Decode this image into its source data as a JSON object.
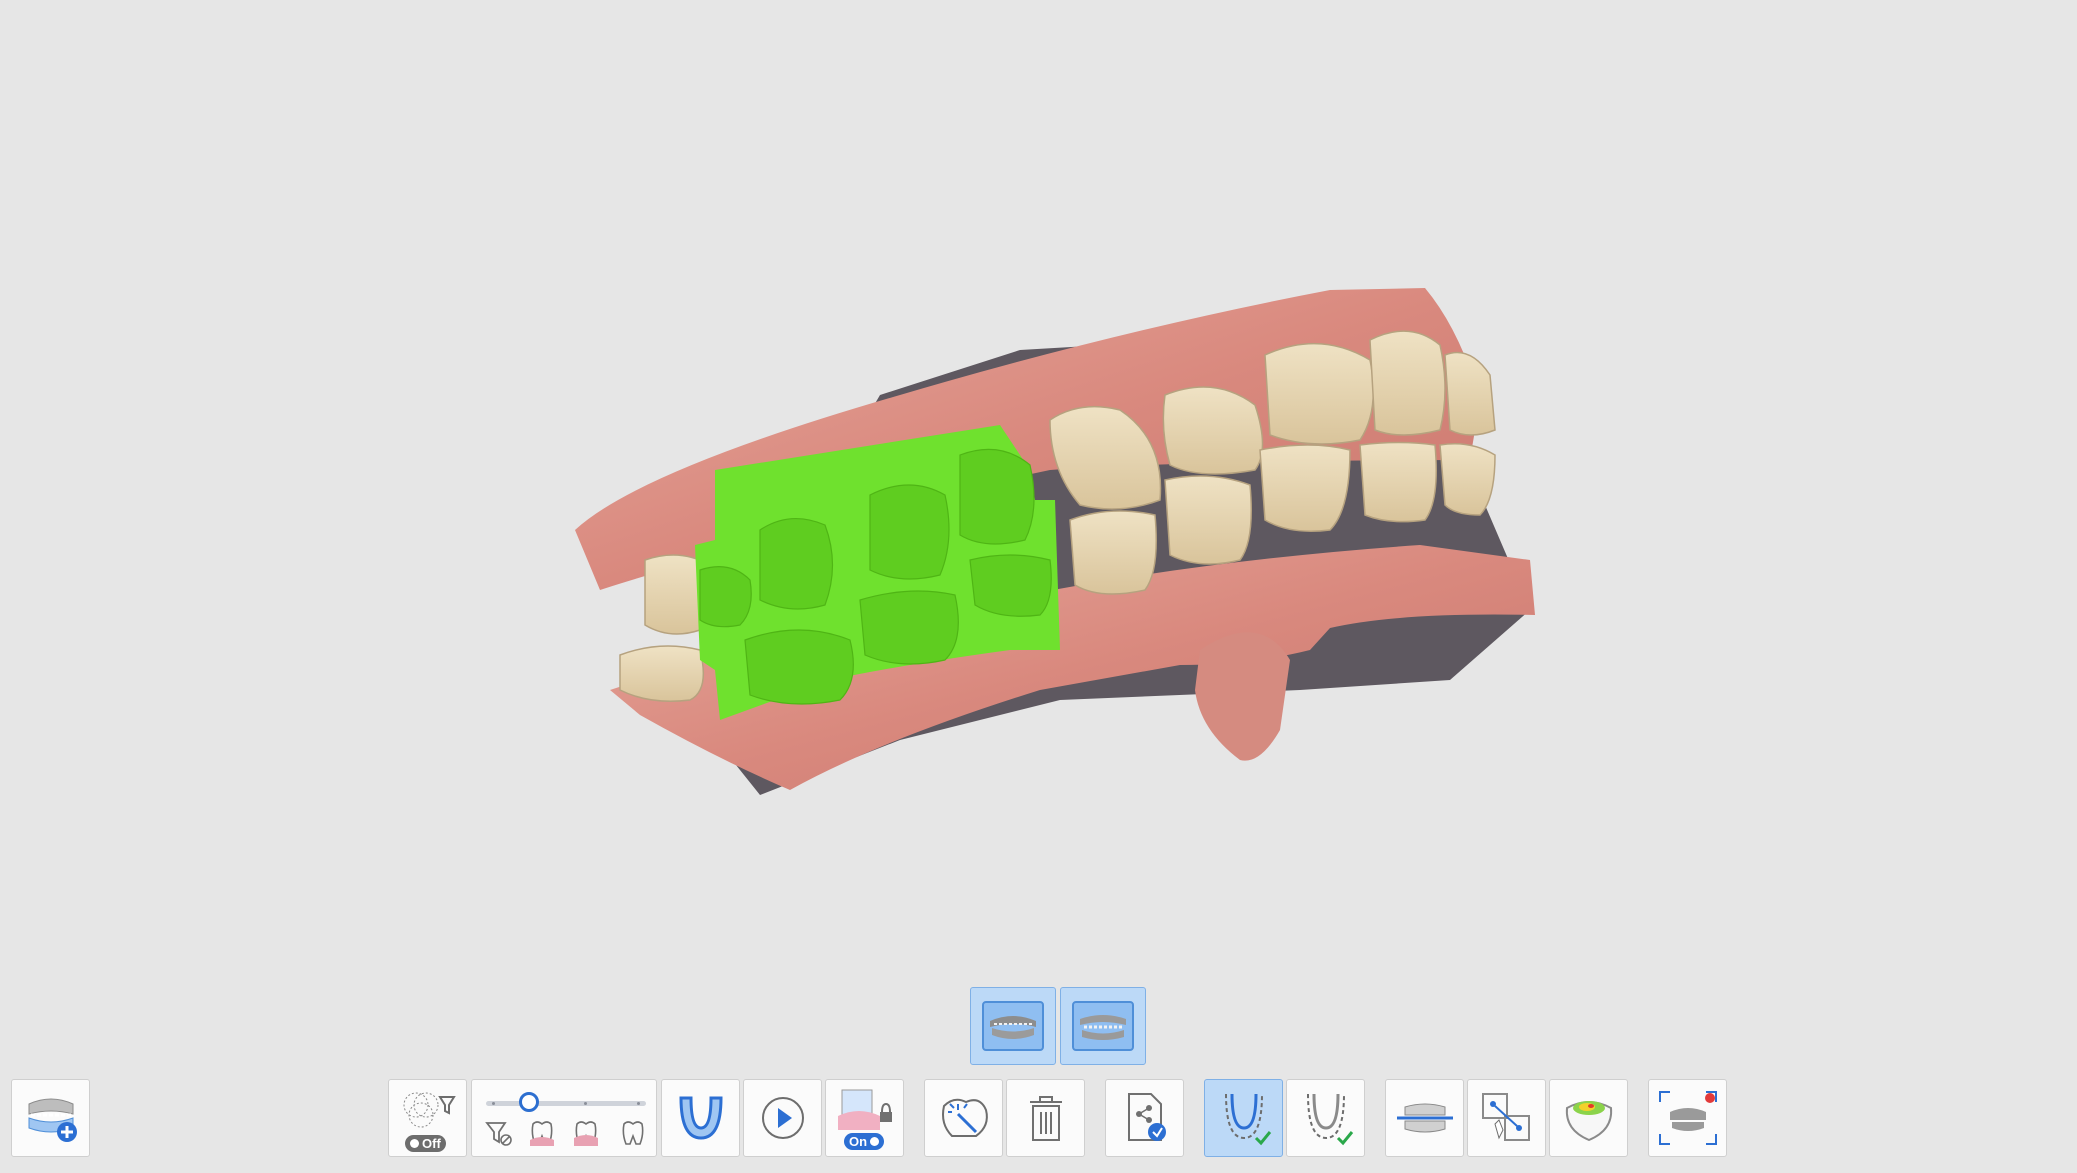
{
  "viewport": {
    "background": "#e6e6e6",
    "scan_colors": {
      "gum": "#d98a80",
      "teeth": "#e3d2ad",
      "selection": "#6fe12e",
      "base": "#5e5860"
    }
  },
  "view_options": [
    {
      "id": "view-teeth-bite",
      "icon": "maxilla-mandible-bite-icon",
      "active": true
    },
    {
      "id": "view-teeth-front",
      "icon": "front-teeth-view-icon",
      "active": true
    }
  ],
  "toolbar": {
    "add_data_icon": "add-data-icon",
    "filter": {
      "icon": "filter-overlap-icon",
      "state_label": "Off"
    },
    "depth": {
      "level_fraction": 0.27,
      "icons": [
        "filter-clear-icon",
        "tooth-depth-icon",
        "tooth-depth-2-icon",
        "tooth-outline-icon"
      ]
    },
    "tools": [
      {
        "id": "arch-tool",
        "icon": "arch-icon"
      },
      {
        "id": "play-tool",
        "icon": "play-icon"
      },
      {
        "id": "lock-tool",
        "icon": "tooth-lock-icon",
        "state_label": "On"
      },
      {
        "id": "magic-select-tool",
        "icon": "magic-wand-tooth-icon"
      },
      {
        "id": "delete-tool",
        "icon": "trash-icon"
      },
      {
        "id": "export-tool",
        "icon": "file-export-icon"
      },
      {
        "id": "maxilla-check-tool",
        "icon": "maxilla-check-icon",
        "active": true
      },
      {
        "id": "mandible-check-tool",
        "icon": "mandible-check-icon"
      },
      {
        "id": "occlusion-tool",
        "icon": "bite-plane-icon"
      },
      {
        "id": "align-tool",
        "icon": "point-align-icon"
      },
      {
        "id": "heatmap-tool",
        "icon": "occlusion-heatmap-icon"
      },
      {
        "id": "capture-tool",
        "icon": "screen-capture-icon"
      }
    ]
  }
}
